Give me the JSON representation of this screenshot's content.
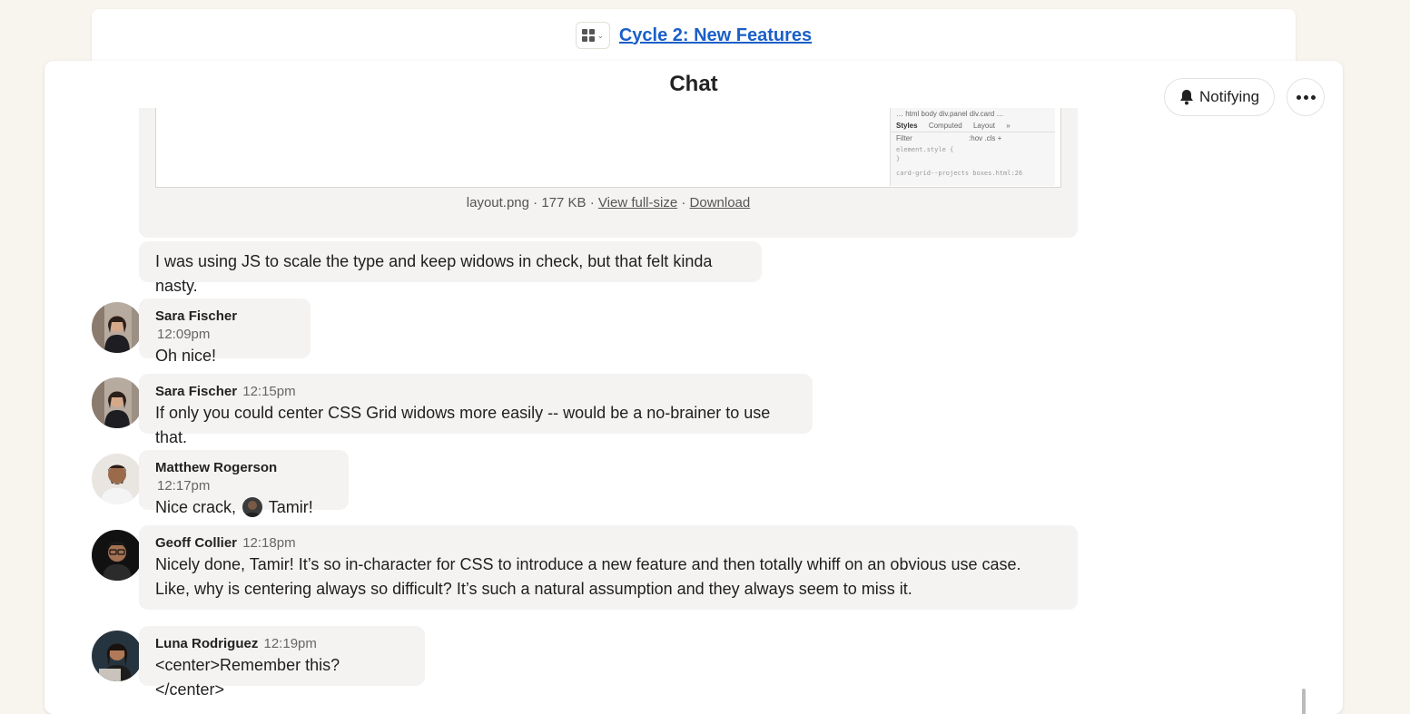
{
  "project": {
    "title": "Cycle 2: New Features"
  },
  "chat": {
    "title": "Chat",
    "notify_label": "Notifying"
  },
  "attachment": {
    "filename": "layout.png",
    "size": "177 KB",
    "view_label": "View full-size",
    "download_label": "Download",
    "devtools": {
      "breadcrumb": "…  html  body  div.panel  div.card  …",
      "tabs": [
        "Styles",
        "Computed",
        "Layout",
        "»"
      ],
      "filter": "Filter",
      "filter_opts": ":hov  .cls  +",
      "code1": "element.style {",
      "code2": "}",
      "code3": "card-grid--projects    boxes.html:26"
    }
  },
  "messages": [
    {
      "name": "",
      "time": "",
      "text": "I was using JS to scale the type and keep widows in check, but that felt kinda nasty."
    },
    {
      "name": "Sara Fischer",
      "time": "12:09pm",
      "text": "Oh nice!"
    },
    {
      "name": "Sara Fischer",
      "time": "12:15pm",
      "text": "If only you could center CSS Grid widows more easily -- would be a no-brainer to use that."
    },
    {
      "name": "Matthew Rogerson",
      "time": "12:17pm",
      "text_before": "Nice crack,",
      "mention": "Tamir!"
    },
    {
      "name": "Geoff Collier",
      "time": "12:18pm",
      "text": "Nicely done, Tamir! It’s so in-character for CSS to introduce a new feature and then totally whiff on an obvious use case. Like, why is centering always so difficult? It’s such a natural assumption and they always seem to miss it."
    },
    {
      "name": "Luna Rodriguez",
      "time": "12:19pm",
      "text": "<center>Remember this?</center>"
    }
  ],
  "icons": {
    "grid": "grid-icon",
    "bell": "bell-icon",
    "more": "more-icon"
  }
}
